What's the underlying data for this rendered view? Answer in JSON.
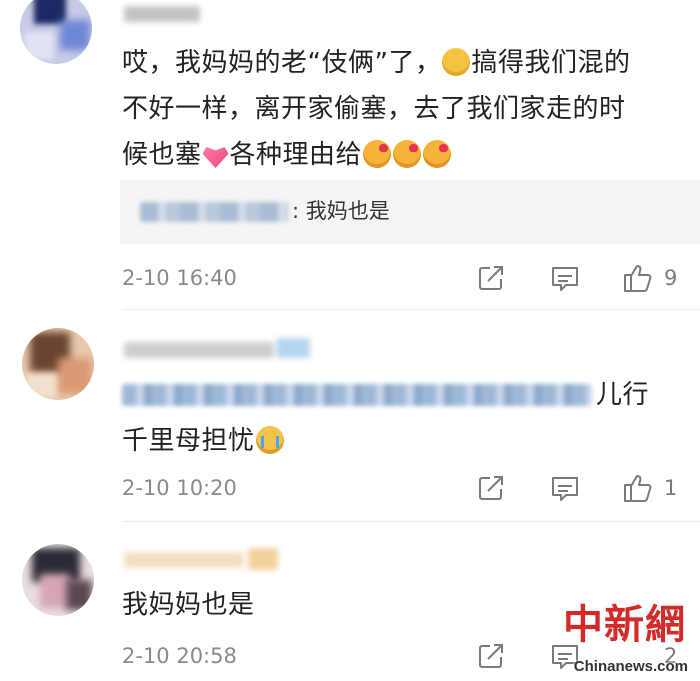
{
  "comments": [
    {
      "text_line1": "哎，我妈妈的老“伎俩”了，",
      "text_line1_b": "搞得我们混的",
      "text_line2": "不好一样，离开家偷塞，去了我们家走的时",
      "text_line3_a": "候也塞",
      "text_line3_b": "各种理由给",
      "reply": {
        "text": ": 我妈也是"
      },
      "time": "2-10 16:40",
      "likes": "9"
    },
    {
      "text_a": "儿行",
      "text_line2": "千里母担忧",
      "time": "2-10 10:20",
      "likes": "1"
    },
    {
      "text": "我妈妈也是",
      "time": "2-10 20:58",
      "likes": "2"
    }
  ],
  "icons": [
    "share-icon",
    "comment-icon",
    "like-icon"
  ],
  "watermark": {
    "cn": "中新網",
    "en": "Chinanews.com"
  }
}
